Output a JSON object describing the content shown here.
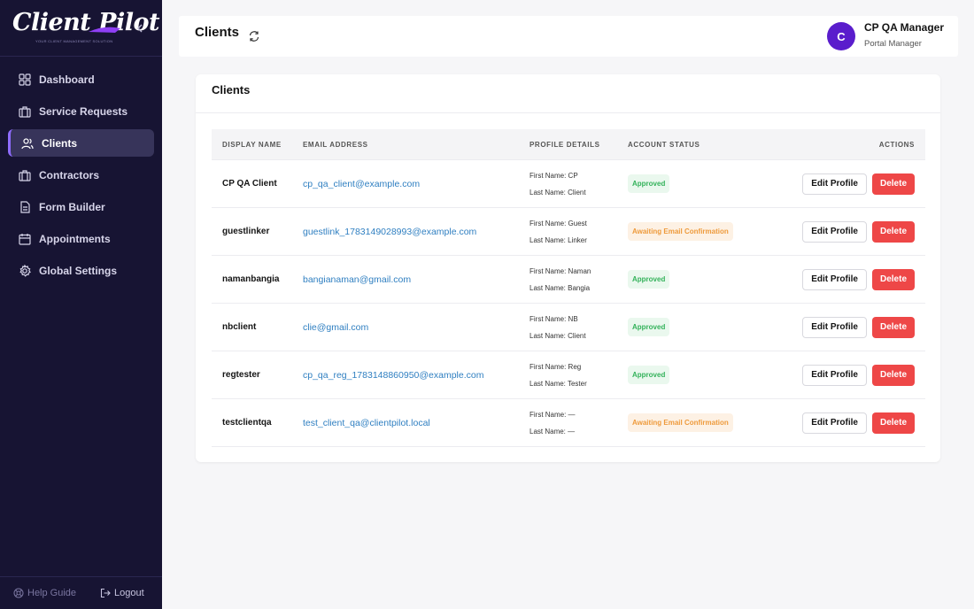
{
  "app": {
    "logo_text": "Client Pilot",
    "logo_tagline": "YOUR CLIENT MANAGEMENT SOLUTION",
    "accent_color": "#8f6cff",
    "sidebar_bg": "#171433"
  },
  "sidebar": {
    "items": [
      {
        "label": "Dashboard",
        "icon": "grid-icon",
        "active": false
      },
      {
        "label": "Service Requests",
        "icon": "briefcase-icon",
        "active": false
      },
      {
        "label": "Clients",
        "icon": "users-icon",
        "active": true
      },
      {
        "label": "Contractors",
        "icon": "briefcase-icon",
        "active": false
      },
      {
        "label": "Form Builder",
        "icon": "document-icon",
        "active": false
      },
      {
        "label": "Appointments",
        "icon": "calendar-icon",
        "active": false
      },
      {
        "label": "Global Settings",
        "icon": "gear-icon",
        "active": false
      }
    ],
    "help_label": "Help Guide",
    "logout_label": "Logout"
  },
  "header": {
    "title": "Clients",
    "user": {
      "initial": "C",
      "name": "CP QA Manager",
      "role": "Portal Manager"
    }
  },
  "card": {
    "title": "Clients",
    "columns": [
      "DISPLAY NAME",
      "EMAIL ADDRESS",
      "PROFILE DETAILS",
      "ACCOUNT STATUS",
      "ACTIONS"
    ],
    "rows": [
      {
        "name": "CP QA Client",
        "email": "cp_qa_client@example.com",
        "first": "First Name: CP",
        "last": "Last Name: Client",
        "status": "Approved",
        "status_type": "approved",
        "edit": "Edit Profile",
        "delete": "Delete"
      },
      {
        "name": "guestlinker",
        "email": "guestlink_1783149028993@example.com",
        "first": "First Name: Guest",
        "last": "Last Name: Linker",
        "status": "Awaiting Email Confirmation",
        "status_type": "awaiting",
        "edit": "Edit Profile",
        "delete": "Delete"
      },
      {
        "name": "namanbangia",
        "email": "bangianaman@gmail.com",
        "first": "First Name: Naman",
        "last": "Last Name: Bangia",
        "status": "Approved",
        "status_type": "approved",
        "edit": "Edit Profile",
        "delete": "Delete"
      },
      {
        "name": "nbclient",
        "email": "clie@gmail.com",
        "first": "First Name: NB",
        "last": "Last Name: Client",
        "status": "Approved",
        "status_type": "approved",
        "edit": "Edit Profile",
        "delete": "Delete"
      },
      {
        "name": "regtester",
        "email": "cp_qa_reg_1783148860950@example.com",
        "first": "First Name: Reg",
        "last": "Last Name: Tester",
        "status": "Approved",
        "status_type": "approved",
        "edit": "Edit Profile",
        "delete": "Delete"
      },
      {
        "name": "testclientqa",
        "email": "test_client_qa@clientpilot.local",
        "first": "First Name: —",
        "last": "Last Name: —",
        "status": "Awaiting Email Confirmation",
        "status_type": "awaiting",
        "edit": "Edit Profile",
        "delete": "Delete"
      }
    ]
  }
}
